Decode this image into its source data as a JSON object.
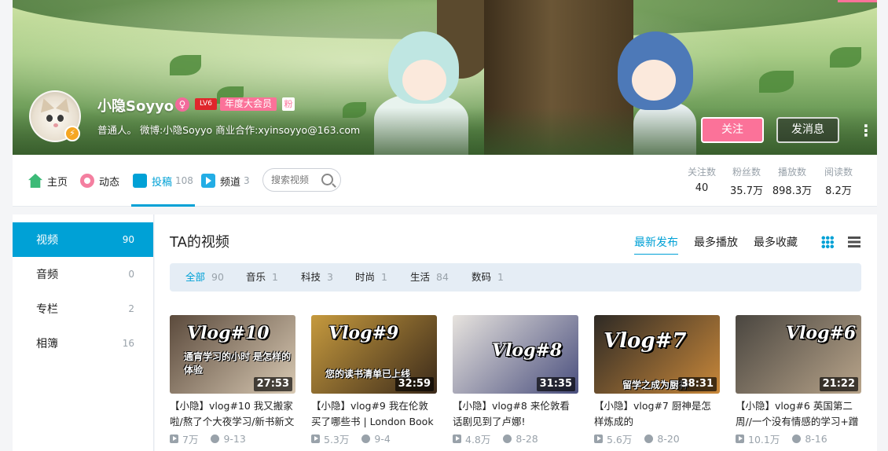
{
  "profile": {
    "name": "小隐Soyyo",
    "gender_symbol": "♀",
    "level": "LV6",
    "vip": "年度大会员",
    "fan_badge": "粉",
    "sign": "普通人。 微博:小隐Soyyo 商业合作:xyinsoyyo@163.com",
    "follow_label": "关注",
    "message_label": "发消息",
    "more_label": "⋮"
  },
  "nav": {
    "home": "主页",
    "dynamic": "动态",
    "posts": "投稿",
    "posts_count": "108",
    "channels": "频道",
    "channels_count": "3",
    "search_placeholder": "搜索视频"
  },
  "stats": [
    {
      "label": "关注数",
      "value": "40"
    },
    {
      "label": "粉丝数",
      "value": "35.7万"
    },
    {
      "label": "播放数",
      "value": "898.3万"
    },
    {
      "label": "阅读数",
      "value": "8.2万"
    }
  ],
  "sidebar": [
    {
      "label": "视频",
      "count": "90"
    },
    {
      "label": "音频",
      "count": "0"
    },
    {
      "label": "专栏",
      "count": "2"
    },
    {
      "label": "相簿",
      "count": "16"
    }
  ],
  "main": {
    "title": "TA的视频",
    "sorts": [
      "最新发布",
      "最多播放",
      "最多收藏"
    ],
    "filters": [
      {
        "label": "全部",
        "count": "90"
      },
      {
        "label": "音乐",
        "count": "1"
      },
      {
        "label": "科技",
        "count": "3"
      },
      {
        "label": "时尚",
        "count": "1"
      },
      {
        "label": "生活",
        "count": "84"
      },
      {
        "label": "数码",
        "count": "1"
      }
    ]
  },
  "videos": [
    {
      "logo": "Vlog#10",
      "sub": "通宵学习的小时 是怎样的体验",
      "duration": "27:53",
      "title": "【小隐】vlog#10 我又搬家啦/熬了个大夜学习/新书新文",
      "plays": "7万",
      "date": "9-13",
      "bg1": "#5b4a3c",
      "bg2": "#d8c9b3"
    },
    {
      "logo": "Vlog#9",
      "sub": "您的读书清单已上线",
      "duration": "32:59",
      "title": "【小隐】vlog#9 我在伦敦买了哪些书 | London Book",
      "plays": "5.3万",
      "date": "9-4",
      "bg1": "#c69a3e",
      "bg2": "#3b2a1a"
    },
    {
      "logo": "Vlog#8",
      "sub": "",
      "duration": "31:35",
      "title": "【小隐】vlog#8 来伦敦看话剧见到了卢娜!",
      "plays": "4.8万",
      "date": "8-28",
      "bg1": "#e7e3de",
      "bg2": "#4a4f7e"
    },
    {
      "logo": "Vlog#7",
      "sub": "留学之成为厨神",
      "duration": "38:31",
      "title": "【小隐】vlog#7 厨神是怎样炼成的",
      "plays": "5.6万",
      "date": "8-20",
      "bg1": "#2e2a25",
      "bg2": "#c9883a"
    },
    {
      "logo": "Vlog#6",
      "sub": "",
      "duration": "21:22",
      "title": "【小隐】vlog#6 英国第二周//一个没有情感的学习+蹭",
      "plays": "10.1万",
      "date": "8-16",
      "bg1": "#4a4640",
      "bg2": "#b8a48a"
    }
  ]
}
